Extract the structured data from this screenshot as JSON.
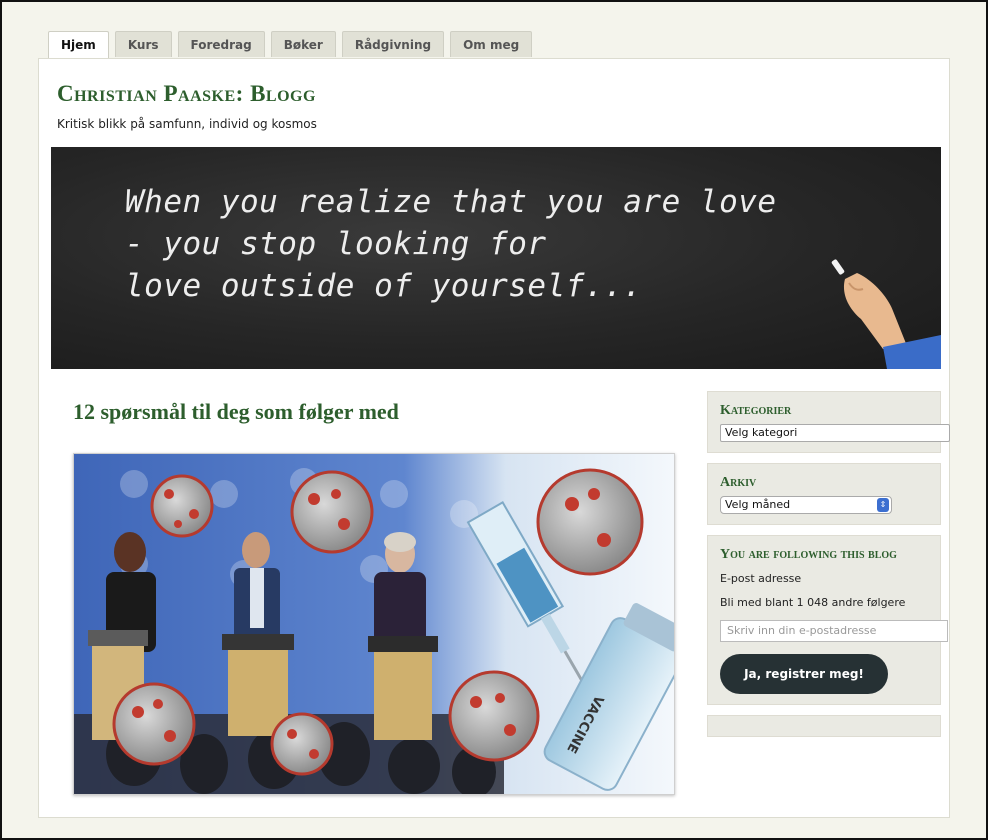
{
  "nav": {
    "tabs": [
      {
        "label": "Hjem",
        "active": true
      },
      {
        "label": "Kurs"
      },
      {
        "label": "Foredrag"
      },
      {
        "label": "Bøker"
      },
      {
        "label": "Rådgivning"
      },
      {
        "label": "Om meg"
      }
    ]
  },
  "header": {
    "title": "Christian Paaske: Blogg",
    "tagline": "Kritisk blikk på samfunn, individ og kosmos"
  },
  "banner": {
    "lines": [
      "When you realize that you are love",
      "- you stop looking for",
      "love outside of yourself..."
    ]
  },
  "post": {
    "title": "12 spørsmål til deg som følger med",
    "image_caption": "VACCINE"
  },
  "sidebar": {
    "categories": {
      "title": "Kategorier",
      "select": "Velg kategori"
    },
    "archive": {
      "title": "Arkiv",
      "select": "Velg måned"
    },
    "follow": {
      "title": "You are following this blog",
      "email_label": "E-post adresse",
      "followers_text": "Bli med blant 1 048 andre følgere",
      "email_placeholder": "Skriv inn din e-postadresse",
      "register_button": "Ja, registrer meg!"
    }
  },
  "colors": {
    "accent": "#2d5e2d",
    "button": "#263134",
    "banner_bg": "#262626"
  }
}
